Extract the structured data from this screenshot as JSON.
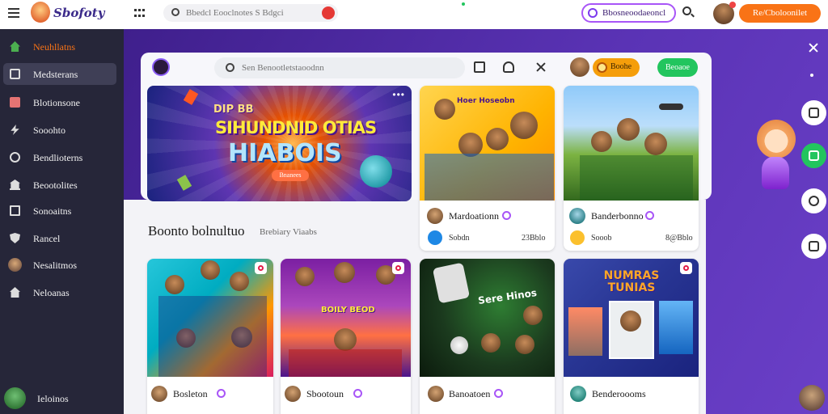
{
  "header": {
    "logo_text": "Sbofoty",
    "search_placeholder": "Bbedcl Eooclnotes S Bdgci",
    "search_badge": "",
    "pill_label": "Bbosneoodaeoncl",
    "cta_label": "Re/Cboloonilet"
  },
  "sidebar": {
    "items": [
      {
        "label": "Neuhllatns",
        "icon": "home-icon"
      },
      {
        "label": "Medsterans",
        "icon": "house-icon"
      },
      {
        "label": "Blotionsone",
        "icon": "gift-icon"
      },
      {
        "label": "Sooohto",
        "icon": "bolt-icon"
      },
      {
        "label": "Bendlioterns",
        "icon": "circle-icon"
      },
      {
        "label": "Beootolites",
        "icon": "bank-icon"
      },
      {
        "label": "Sonoaitns",
        "icon": "document-icon"
      },
      {
        "label": "Rancel",
        "icon": "shield-icon"
      },
      {
        "label": "Nesalitmos",
        "icon": "avatar-icon"
      },
      {
        "label": "Neloanas",
        "icon": "house-icon"
      }
    ],
    "bottom_label": "Ieloinos"
  },
  "panel": {
    "search_placeholder": "Sen Benootletstaoodnn",
    "coin_label": "Boohe",
    "green_label": "Beoaoe"
  },
  "hero": {
    "line1": "DIP BB",
    "line2": "SIHUNDNID OTIAS",
    "line3": "HIABOIS",
    "tag": "Bnanees"
  },
  "section": {
    "title": "Boonto bolnultuo",
    "subtitle": "Brebiary Viaabs"
  },
  "featured_cards": [
    {
      "name": "Mardoationn",
      "meta": "Sobdn",
      "value": "23Bblo",
      "thumb_text": "Hoer Hoseobn"
    },
    {
      "name": "Banderbonno",
      "meta": "Sooob",
      "value": "8@Bblo",
      "thumb_text": ""
    }
  ],
  "grid_cards": [
    {
      "name": "Bosleton",
      "thumb_text": ""
    },
    {
      "name": "Sbootoun",
      "thumb_text": "BOILY BEOD"
    },
    {
      "name": "Banoatoen",
      "thumb_text": "Sere Hinos"
    },
    {
      "name": "Benderoooms",
      "thumb_text": "NUMRAS TUNIAS"
    }
  ],
  "colors": {
    "sidebar_bg": "#262639",
    "accent_orange": "#f97316",
    "accent_purple": "#a855f7",
    "accent_green": "#22c55e",
    "brand_bg": "#5a33b5"
  }
}
